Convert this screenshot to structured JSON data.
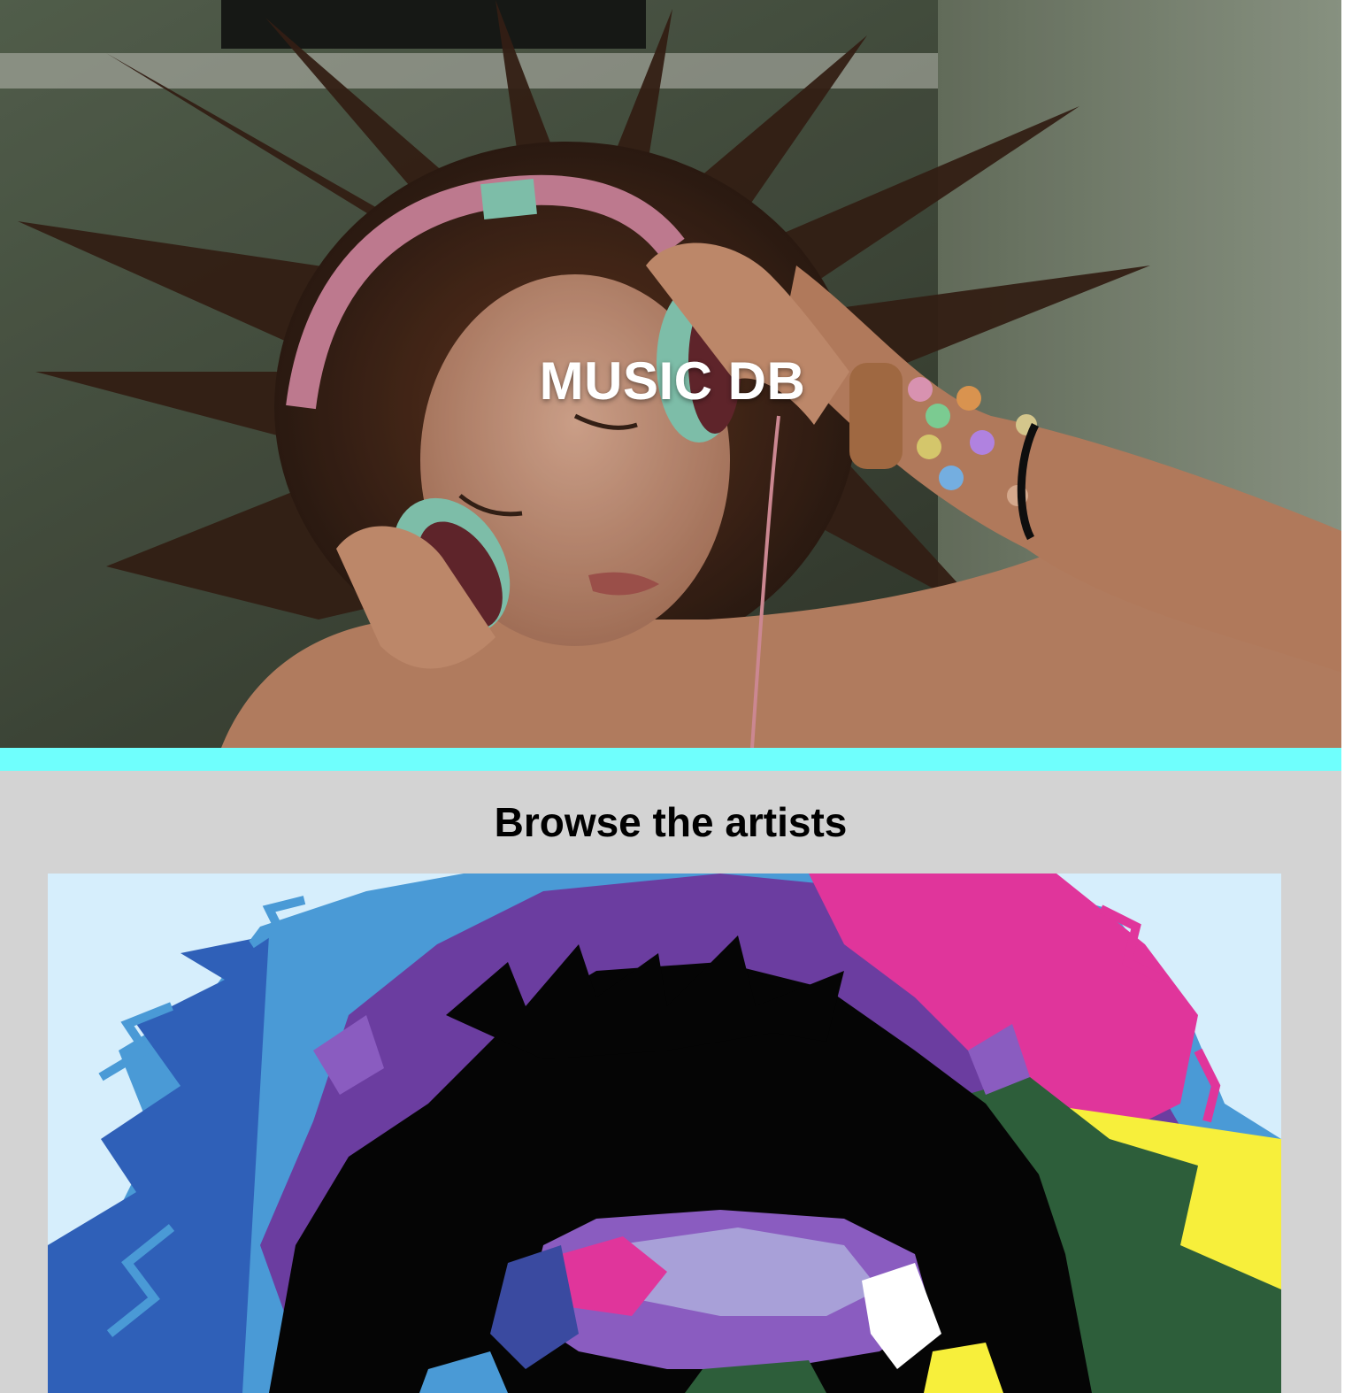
{
  "hero": {
    "title": "MUSIC DB",
    "image": "photo of a girl with tossed hair wearing pink and mint headphones"
  },
  "accent_color": "#6ffffd",
  "artists_section": {
    "heading": "Browse the artists",
    "cards": [
      {
        "image": "colorful geometric pop-art portrait of an artist with large curly hair"
      }
    ]
  }
}
